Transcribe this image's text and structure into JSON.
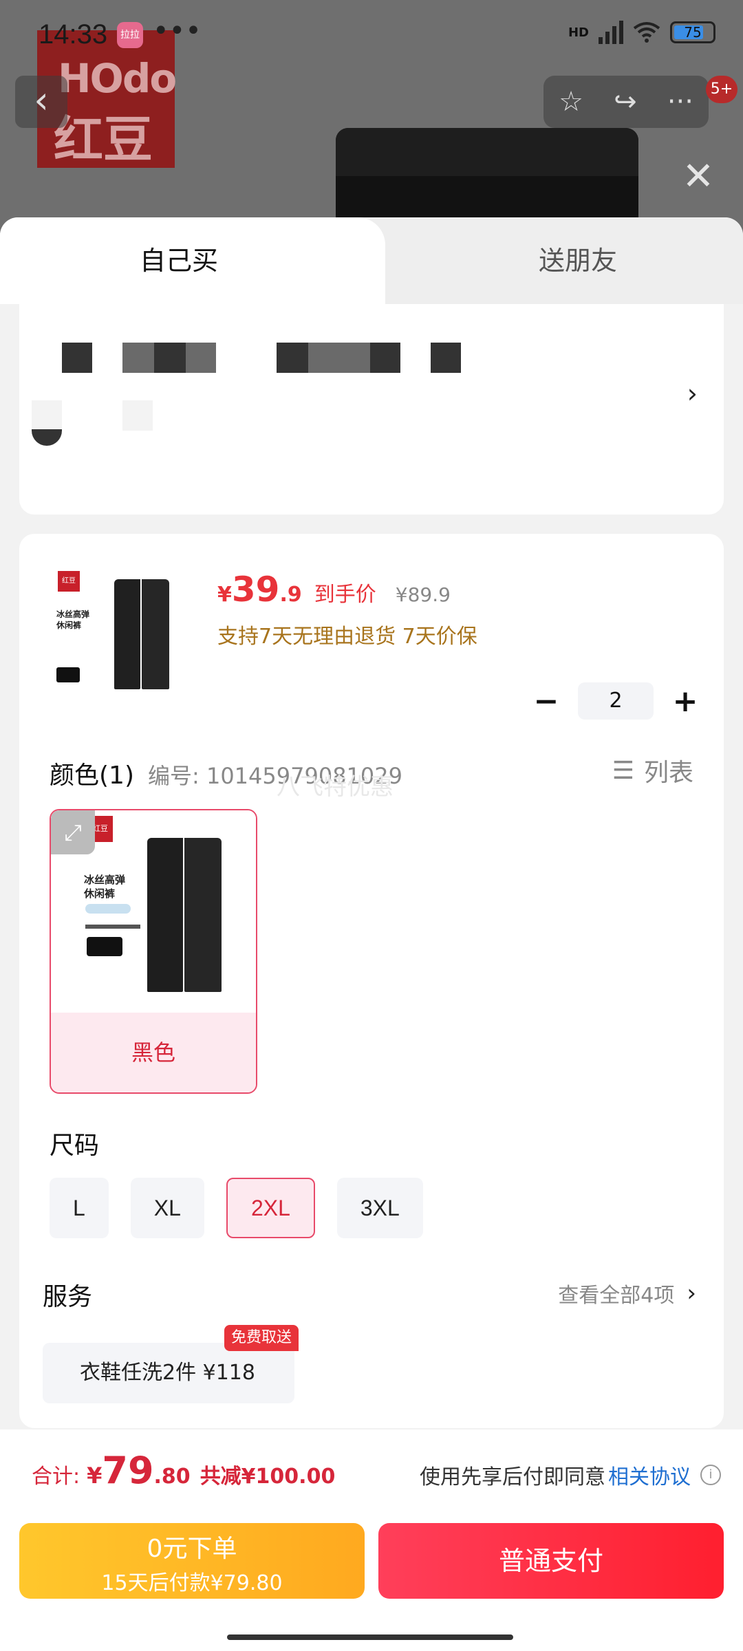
{
  "status_bar": {
    "time": "14:33",
    "app_badge": "拉拉",
    "more": "•••",
    "network": "HD",
    "battery": "75"
  },
  "background": {
    "brand_top": "HOdo",
    "brand_bottom": "红豆"
  },
  "nav": {
    "back": "‹",
    "star": "☆",
    "share": "↪",
    "more": "···",
    "notification_count": "5+",
    "close": "✕"
  },
  "tabs": [
    {
      "label": "自己买"
    },
    {
      "label": "送朋友"
    }
  ],
  "address": {
    "arrow": "›"
  },
  "product": {
    "thumb_brand": "红豆",
    "thumb_line1": "冰丝高弹",
    "thumb_line2": "休闲裤",
    "price_symbol": "¥",
    "price_int": "39",
    "price_dec": ".9",
    "price_tag": "到手价",
    "original_price": "¥89.9",
    "promise": "支持7天无理由退货  7天价保",
    "quantity": "2",
    "minus": "−",
    "plus": "+"
  },
  "color": {
    "title": "颜色(1)",
    "sku": "编号: 10145979081029",
    "list_icon": "☰",
    "list_label": "列表",
    "watermark": "八飞特优惠",
    "options": [
      {
        "label": "黑色",
        "selected": true
      }
    ]
  },
  "size": {
    "title": "尺码",
    "options": [
      {
        "label": "L"
      },
      {
        "label": "XL"
      },
      {
        "label": "2XL"
      },
      {
        "label": "3XL"
      }
    ],
    "selected": "2XL"
  },
  "service": {
    "title": "服务",
    "view_all": "查看全部4项",
    "chevron": "›",
    "chip_label": "衣鞋任洗2件  ¥118",
    "chip_badge": "免费取送"
  },
  "footer": {
    "total_label": "合计:",
    "total_symbol": "¥",
    "total_int": "79",
    "total_dec": ".80",
    "discount": "共减¥100.00",
    "agree_text": "使用先享后付即同意",
    "agree_link": "相关协议",
    "info_icon": "i",
    "later_title": "0元下单",
    "later_sub": "15天后付款¥79.80",
    "pay_label": "普通支付"
  },
  "colors": {
    "accent": "#e8333a",
    "promise": "#a8741d",
    "link": "#1f6fd1",
    "later_btn": "#ffb624",
    "pay_btn": "#ff2f45"
  }
}
